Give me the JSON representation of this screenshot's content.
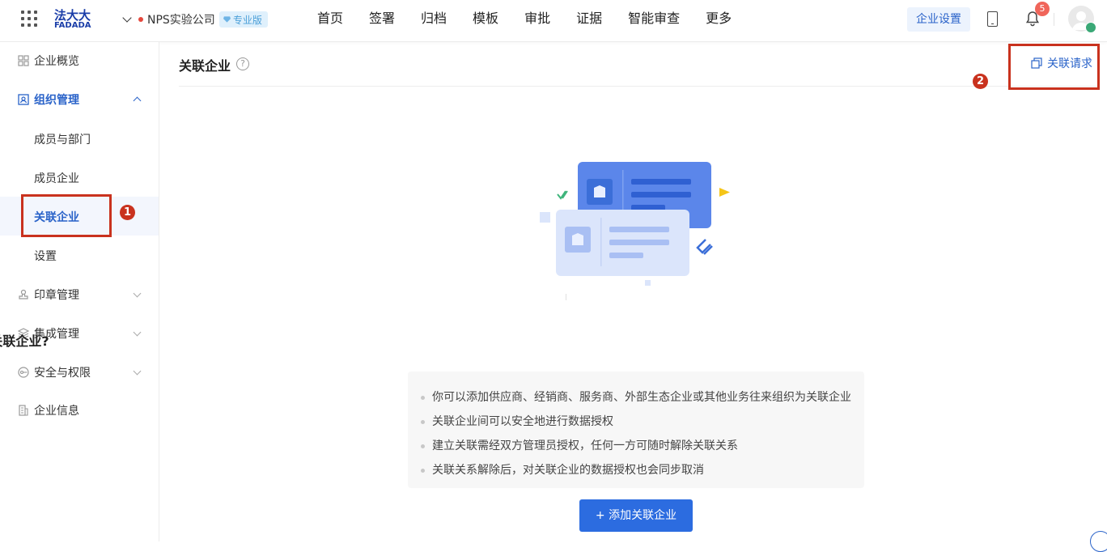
{
  "header": {
    "logo_cn": "法大大",
    "logo_en": "FADADA",
    "company": "NPS实验公司",
    "edition_badge": "专业版",
    "nav": [
      "首页",
      "签署",
      "归档",
      "模板",
      "审批",
      "证据",
      "智能审查",
      "更多"
    ],
    "settings_button": "企业设置",
    "notification_count": "5"
  },
  "sidebar": {
    "items": [
      {
        "label": "企业概览",
        "icon": "dashboard-icon"
      },
      {
        "label": "组织管理",
        "icon": "org-icon",
        "expanded": true
      },
      {
        "label": "成员与部门"
      },
      {
        "label": "成员企业"
      },
      {
        "label": "关联企业",
        "active": true
      },
      {
        "label": "设置"
      },
      {
        "label": "印章管理",
        "icon": "seal-icon"
      },
      {
        "label": "集成管理",
        "icon": "layers-icon"
      },
      {
        "label": "安全与权限",
        "icon": "security-icon"
      },
      {
        "label": "企业信息",
        "icon": "building-icon"
      }
    ]
  },
  "annotations": {
    "first": "1",
    "second": "2"
  },
  "main": {
    "title": "关联企业",
    "help": "?",
    "request_link": "关联请求",
    "what_title": "什么是关联企业?",
    "info_lines": [
      "你可以添加供应商、经销商、服务商、外部生态企业或其他业务往来组织为关联企业",
      "关联企业间可以安全地进行数据授权",
      "建立关联需经双方管理员授权，任何一方可随时解除关联关系",
      "关联关系解除后，对关联企业的数据授权也会同步取消"
    ],
    "add_button": "+ 添加关联企业"
  },
  "colors": {
    "accent": "#2c6ce0",
    "annotation_red": "#c9321e",
    "active_bg": "#f3f6fd",
    "badge_red": "#f0655a"
  }
}
